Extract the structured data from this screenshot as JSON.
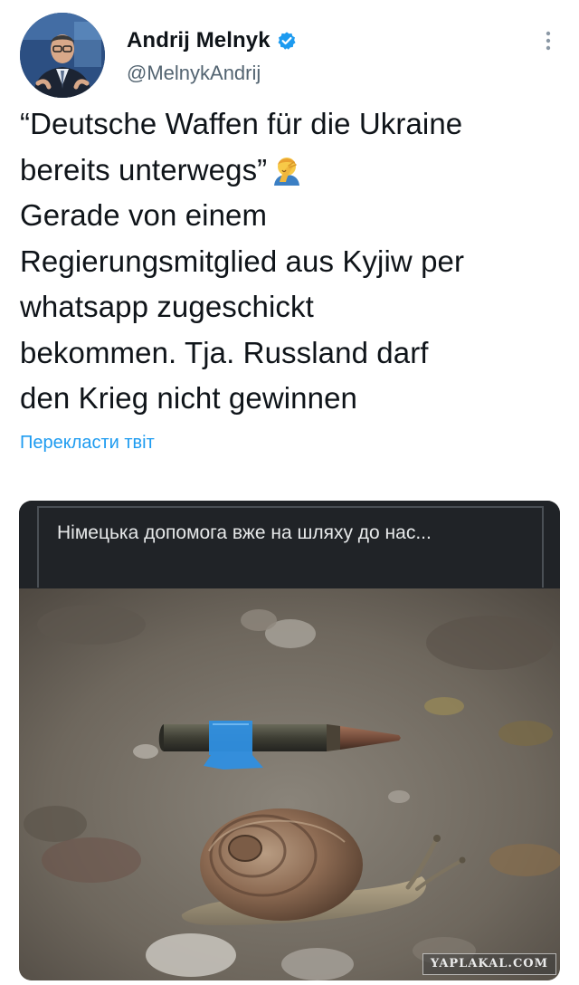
{
  "author": {
    "display_name": "Andrij Melnyk",
    "handle": "@MelnykAndrij",
    "verified": true
  },
  "icons": {
    "verified": "verified-badge-icon",
    "more": "more-vertical-icon",
    "emoji": "face-palm-emoji"
  },
  "tweet": {
    "lines": [
      "“Deutsche Waffen für die Ukraine",
      "bereits unterwegs”",
      "Gerade von einem",
      "Regierungsmitglied aus Kyjiw per",
      "whatsapp zugeschickt",
      "bekommen. Tja. Russland darf",
      "den Krieg nicht gewinnen"
    ],
    "translate_label": "Перекласти твіт"
  },
  "media": {
    "caption": "Німецька допомога вже на шляху до нас...",
    "watermark": "YAPLAKAL.COM"
  },
  "colors": {
    "link": "#1d9bf0",
    "verified": "#1d9bf0",
    "text": "#0f1419",
    "secondary_text": "#536471",
    "caption_bg": "#202327"
  }
}
